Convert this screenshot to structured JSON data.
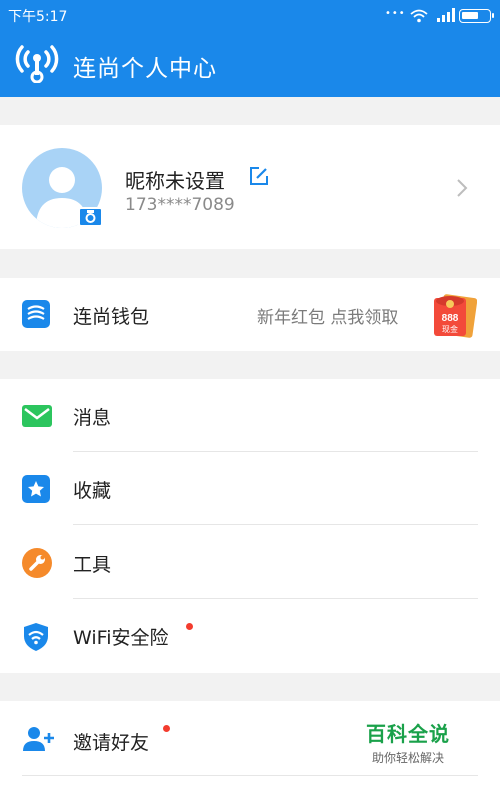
{
  "status_bar": {
    "time": "下午5:17",
    "dots": "•••"
  },
  "app_bar": {
    "title": "连尚个人中心"
  },
  "profile": {
    "nickname": "昵称未设置",
    "phone": "173****7089"
  },
  "wallet": {
    "label": "连尚钱包",
    "promo": "新年红包 点我领取",
    "red_packet_amount": "888",
    "red_packet_text": "现金"
  },
  "menu": [
    {
      "label": "消息",
      "icon": "message-icon",
      "color": "#2cc55e",
      "dot": false
    },
    {
      "label": "收藏",
      "icon": "star-icon",
      "color": "#1a88ea",
      "dot": false
    },
    {
      "label": "工具",
      "icon": "wrench-icon",
      "color": "#f58a2b",
      "dot": false
    },
    {
      "label": "WiFi安全险",
      "icon": "shield-wifi-icon",
      "color": "#1a88ea",
      "dot": true
    }
  ],
  "invite": {
    "label": "邀请好友",
    "dot": true
  },
  "watermark": {
    "title": "百科全说",
    "subtitle": "助你轻松解决"
  },
  "colors": {
    "primary": "#1a88ea",
    "background": "#f2f2f2",
    "badge_red": "#f33c2e"
  }
}
